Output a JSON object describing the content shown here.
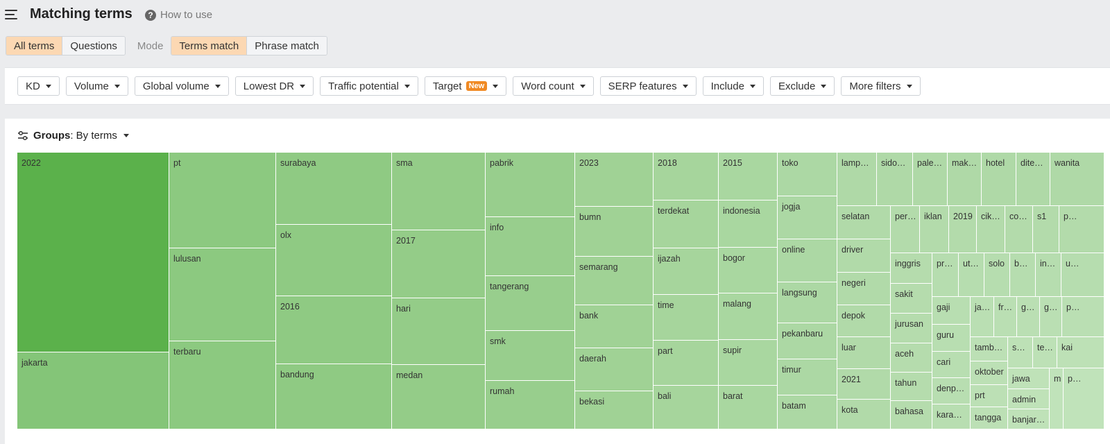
{
  "header": {
    "title": "Matching terms",
    "help_label": "How to use"
  },
  "term_tabs": [
    {
      "label": "All terms",
      "active": true
    },
    {
      "label": "Questions",
      "active": false
    }
  ],
  "mode": {
    "label": "Mode",
    "options": [
      {
        "label": "Terms match",
        "active": true
      },
      {
        "label": "Phrase match",
        "active": false
      }
    ]
  },
  "filters": {
    "kd": "KD",
    "volume": "Volume",
    "global_volume": "Global volume",
    "lowest_dr": "Lowest DR",
    "traffic_potential": "Traffic potential",
    "target": "Target",
    "target_badge": "New",
    "word_count": "Word count",
    "serp_features": "SERP features",
    "include": "Include",
    "exclude": "Exclude",
    "more_filters": "More filters"
  },
  "groups": {
    "label": "Groups",
    "value": ": By terms"
  },
  "colors": {
    "accent_active": "#fcd8b3",
    "badge": "#f08a24",
    "tile_dark": "#5bb14b",
    "tile_mid": "#8cc980",
    "tile_light": "#a9d7a0"
  },
  "tile_labels": {
    "t2022": "2022",
    "jakarta": "jakarta",
    "pt": "pt",
    "lulusan": "lulusan",
    "terbaru": "terbaru",
    "surabaya": "surabaya",
    "olx": "olx",
    "t2016": "2016",
    "bandung": "bandung",
    "sma": "sma",
    "t2017": "2017",
    "hari": "hari",
    "medan": "medan",
    "pabrik": "pabrik",
    "info": "info",
    "tangerang": "tangerang",
    "smk": "smk",
    "rumah": "rumah",
    "t2023": "2023",
    "bumn": "bumn",
    "semarang": "semarang",
    "bank": "bank",
    "daerah": "daerah",
    "bekasi": "bekasi",
    "t2018": "2018",
    "terdekat": "terdekat",
    "ijazah": "ijazah",
    "time": "time",
    "part": "part",
    "bali": "bali",
    "t2015": "2015",
    "indonesia": "indonesia",
    "bogor": "bogor",
    "malang": "malang",
    "supir": "supir",
    "barat": "barat",
    "toko": "toko",
    "jogja": "jogja",
    "online": "online",
    "langsung": "langsung",
    "pekanbaru": "pekanbaru",
    "timur": "timur",
    "batam": "batam",
    "lamp": "lamp…",
    "sido": "sido…",
    "pale": "pale…",
    "mak": "mak…",
    "hotel": "hotel",
    "dite": "dite…",
    "wanita": "wanita",
    "selatan": "selatan",
    "driver": "driver",
    "negeri": "negeri",
    "depok": "depok",
    "luar": "luar",
    "t2021": "2021",
    "kota": "kota",
    "per": "per…",
    "iklan": "iklan",
    "t2019": "2019",
    "cik": "cik…",
    "co": "co…",
    "s1": "s1",
    "p1": "p…",
    "inggris": "inggris",
    "pr": "pr…",
    "ut": "ut…",
    "solo": "solo",
    "b1": "b…",
    "in": "in…",
    "u1": "u…",
    "sakit": "sakit",
    "gaji": "gaji",
    "ja1": "ja…",
    "fr": "fr…",
    "g1": "g…",
    "g2": "g…",
    "p2": "p…",
    "jurusan": "jurusan",
    "guru": "guru",
    "tamb": "tamb…",
    "s2": "s…",
    "te": "te…",
    "kai": "kai",
    "aceh": "aceh",
    "cari": "cari",
    "oktober": "oktober",
    "tahun": "tahun",
    "denp": "denp…",
    "jawa": "jawa",
    "m1": "m",
    "p3": "p…",
    "prt": "prt",
    "admin": "admin",
    "bahasa": "bahasa",
    "kara": "kara…",
    "tangga": "tangga",
    "banjar": "banjar…"
  }
}
